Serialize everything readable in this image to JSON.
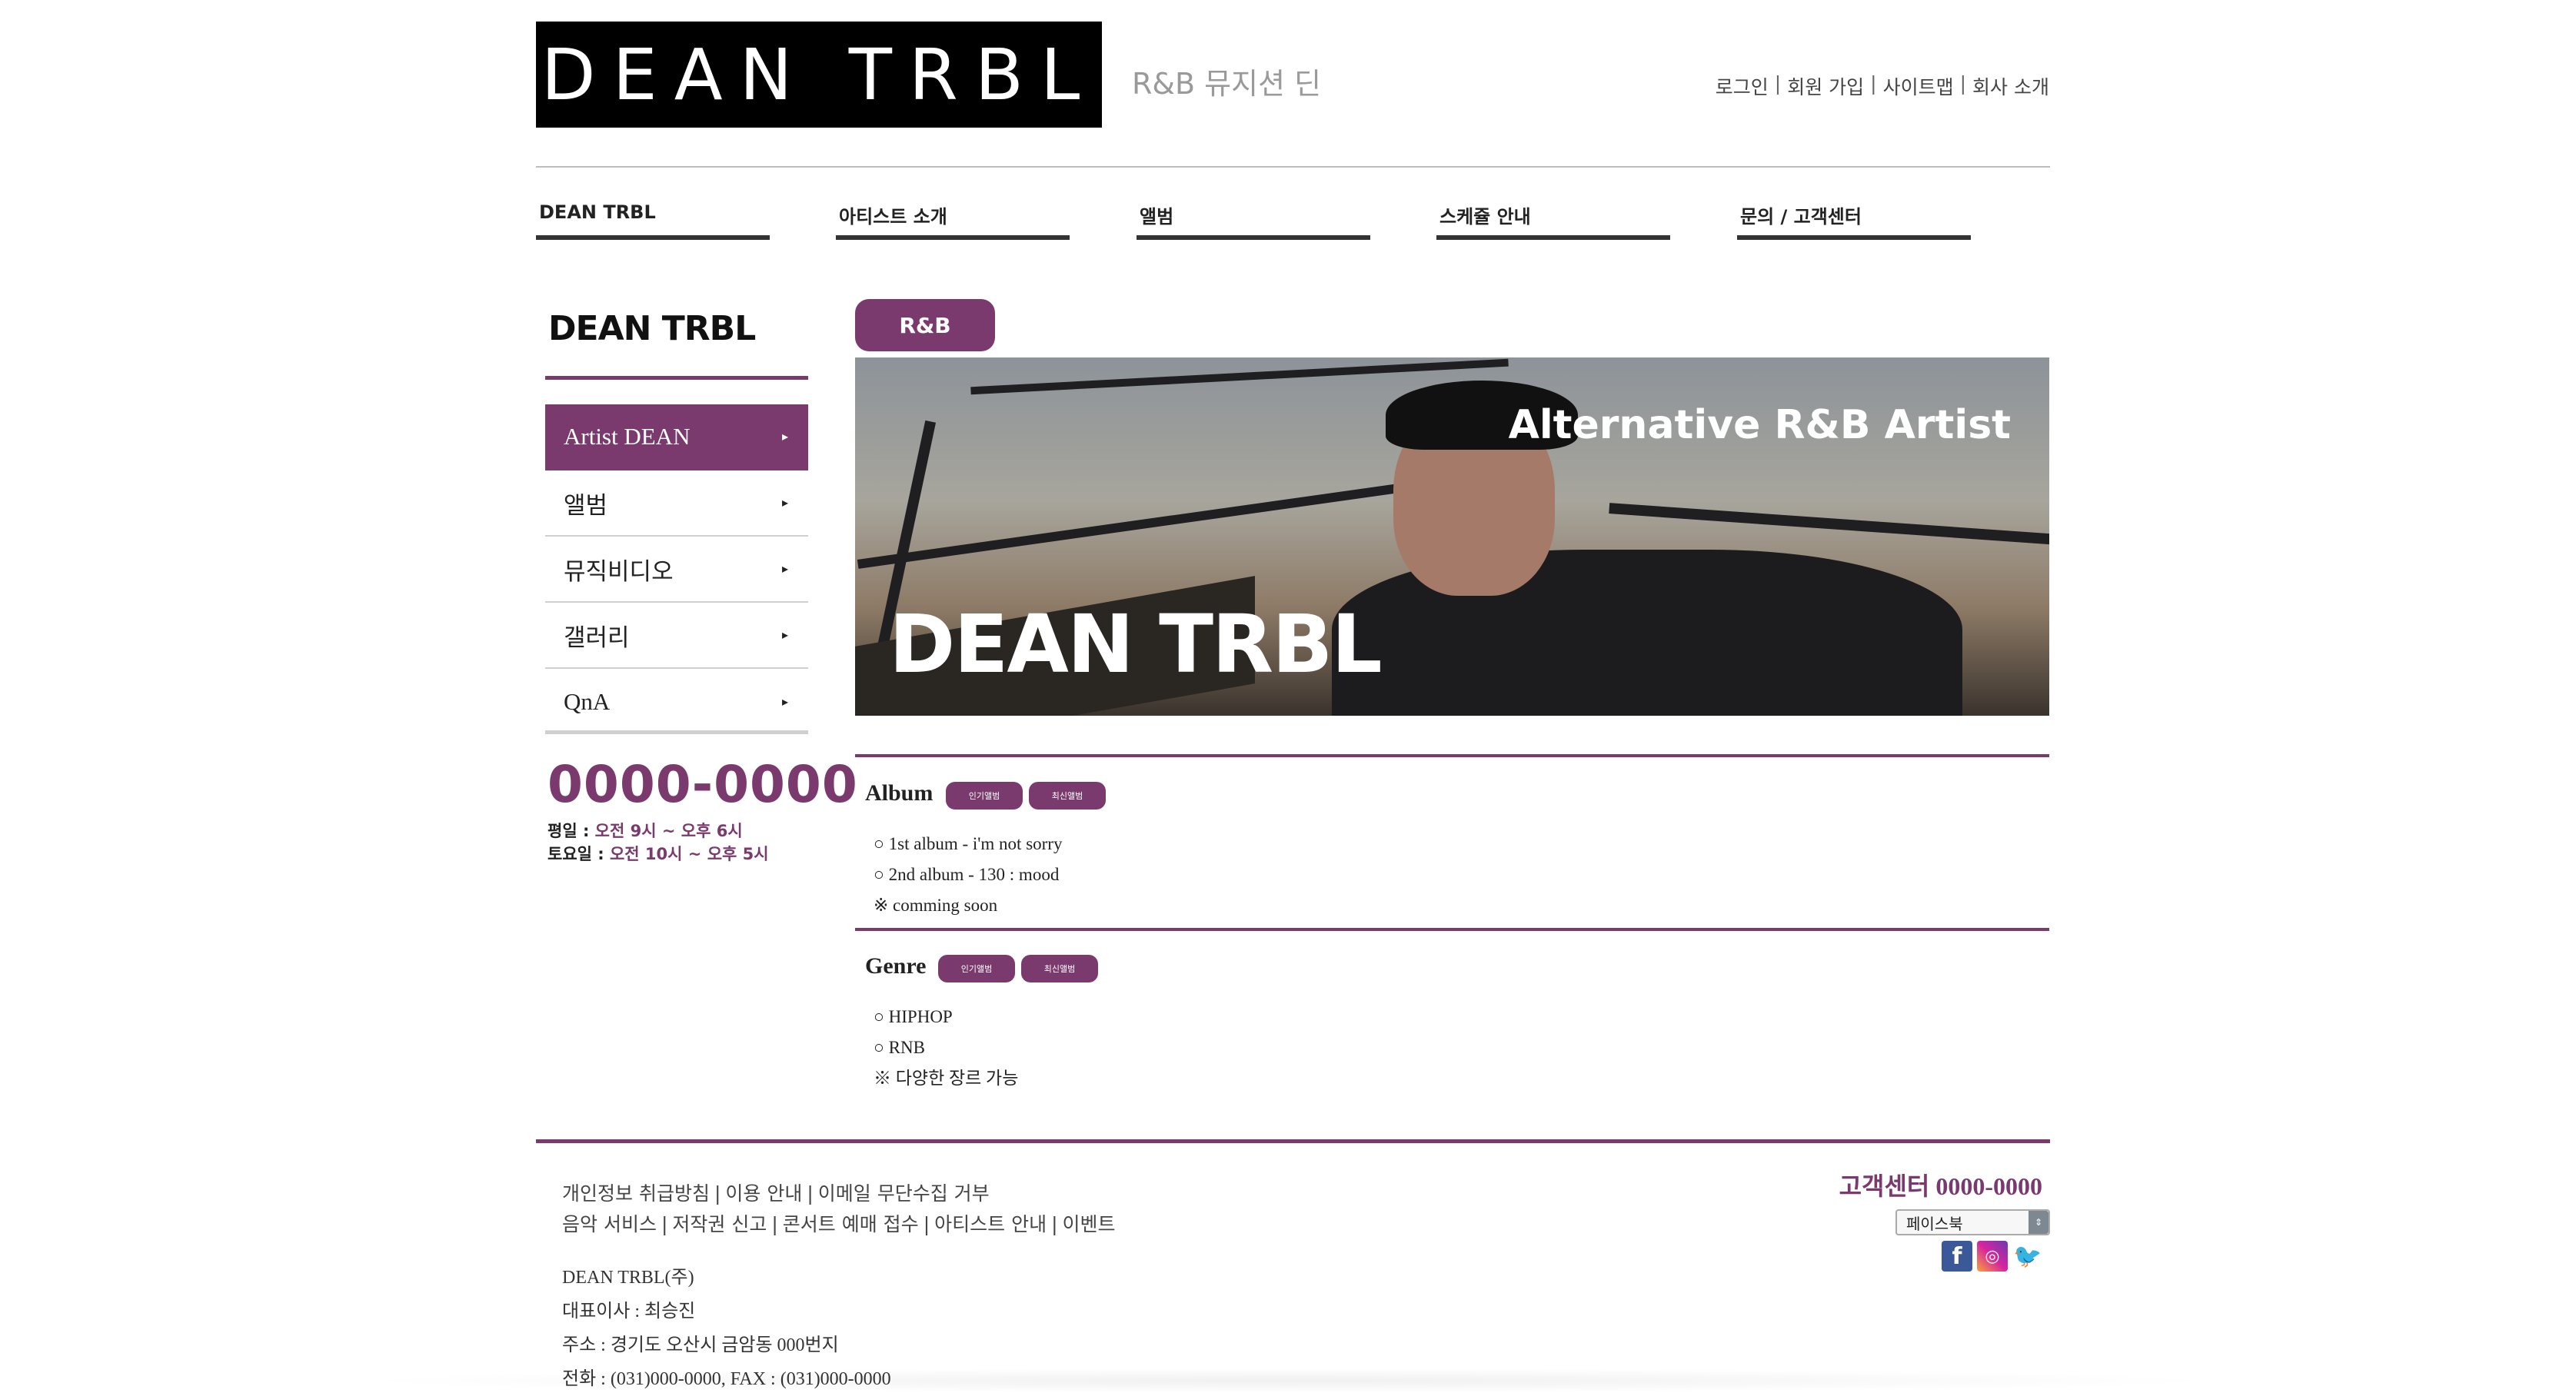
{
  "header": {
    "logo_text": "DEAN TRBL",
    "logo_subtitle": "R&B 뮤지션 딘",
    "util_links": [
      "로그인",
      "회원 가입",
      "사이트맵",
      "회사 소개"
    ]
  },
  "nav": {
    "items": [
      "DEAN TRBL",
      "아티스트 소개",
      "앨범",
      "스케쥴 안내",
      "문의 / 고객센터"
    ]
  },
  "sidebar": {
    "title": "DEAN TRBL",
    "items": [
      {
        "label": "Artist DEAN",
        "arrow": "▸"
      },
      {
        "label": "앨범",
        "arrow": "▸"
      },
      {
        "label": "뮤직비디오",
        "arrow": "▸"
      },
      {
        "label": "갤러리",
        "arrow": "▸"
      },
      {
        "label": "QnA",
        "arrow": "▸"
      }
    ],
    "phone": "0000-0000",
    "hours": [
      {
        "label": "평일 : ",
        "value": "오전 9시 ~ 오후 6시"
      },
      {
        "label": "토요일 : ",
        "value": "오전 10시 ~ 오후 5시"
      }
    ]
  },
  "content": {
    "genre_tag": "R&B",
    "banner": {
      "tagline": "Alternative R&B Artist",
      "name": "DEAN TRBL"
    },
    "album": {
      "title": "Album",
      "buttons": [
        "인기앨범",
        "최신앨범"
      ],
      "items": [
        "○ 1st album - i'm not sorry",
        "○ 2nd album - 130 : mood",
        "※ comming soon"
      ]
    },
    "genre": {
      "title": "Genre",
      "buttons": [
        "인기앨범",
        "최신앨범"
      ],
      "items": [
        "○ HIPHOP",
        "○ RNB",
        "※ 다양한 장르 가능"
      ]
    }
  },
  "footer": {
    "links_row1": [
      "개인정보 취급방침",
      "이용 안내",
      "이메일 무단수집 거부"
    ],
    "links_row2": [
      "음악 서비스",
      "저작권 신고",
      "콘서트 예매 접수",
      "아티스트 안내",
      "이벤트"
    ],
    "company": "DEAN TRBL(주)",
    "ceo": "대표이사 : 최승진",
    "address": "주소 : 경기도 오산시 금암동 000번지",
    "contact": "전화 : (031)000-0000, FAX : (031)000-0000",
    "cs_phone": "고객센터 0000-0000",
    "sns_select": "페이스북",
    "sns_icons": [
      "facebook-icon",
      "instagram-icon",
      "twitter-icon"
    ]
  },
  "colors": {
    "accent": "#7a3a6e",
    "logo_bg": "#000000",
    "text": "#222222"
  }
}
